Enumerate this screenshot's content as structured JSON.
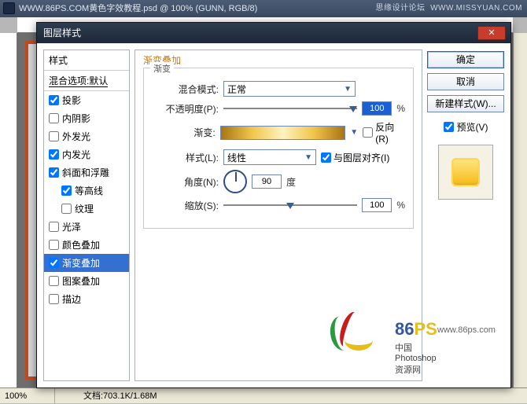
{
  "app": {
    "title": "WWW.86PS.COM黄色字效教程.psd @ 100% (GUNN, RGB/8)",
    "forum": "思缘设计论坛",
    "domain": "WWW.MISSYUAN.COM"
  },
  "status": {
    "zoom": "100%",
    "doc": "文档:703.1K/1.68M"
  },
  "dialog": {
    "title": "图层样式",
    "sidebar": {
      "header": "样式",
      "blend": "混合选项:默认",
      "items": [
        {
          "label": "投影",
          "checked": true,
          "indent": false
        },
        {
          "label": "内阴影",
          "checked": false,
          "indent": false
        },
        {
          "label": "外发光",
          "checked": false,
          "indent": false
        },
        {
          "label": "内发光",
          "checked": true,
          "indent": false
        },
        {
          "label": "斜面和浮雕",
          "checked": true,
          "indent": false
        },
        {
          "label": "等高线",
          "checked": true,
          "indent": true
        },
        {
          "label": "纹理",
          "checked": false,
          "indent": true
        },
        {
          "label": "光泽",
          "checked": false,
          "indent": false
        },
        {
          "label": "颜色叠加",
          "checked": false,
          "indent": false
        },
        {
          "label": "渐变叠加",
          "checked": true,
          "indent": false,
          "selected": true
        },
        {
          "label": "图案叠加",
          "checked": false,
          "indent": false
        },
        {
          "label": "描边",
          "checked": false,
          "indent": false
        }
      ]
    },
    "panel": {
      "title": "渐变叠加",
      "group": "渐变",
      "blend_label": "混合模式:",
      "blend_value": "正常",
      "opacity_label": "不透明度(P):",
      "opacity_value": "100",
      "percent": "%",
      "gradient_label": "渐变:",
      "reverse_label": "反向(R)",
      "style_label": "样式(L):",
      "style_value": "线性",
      "align_label": "与图层对齐(I)",
      "angle_label": "角度(N):",
      "angle_value": "90",
      "degree": "度",
      "scale_label": "缩放(S):",
      "scale_value": "100"
    },
    "buttons": {
      "ok": "确定",
      "cancel": "取消",
      "new": "新建样式(W)...",
      "preview": "预览(V)"
    }
  },
  "watermark": {
    "brand": "86",
    "brand_ps": "PS",
    "url": "www.86ps.com",
    "sub": "中国Photoshop资源网"
  }
}
